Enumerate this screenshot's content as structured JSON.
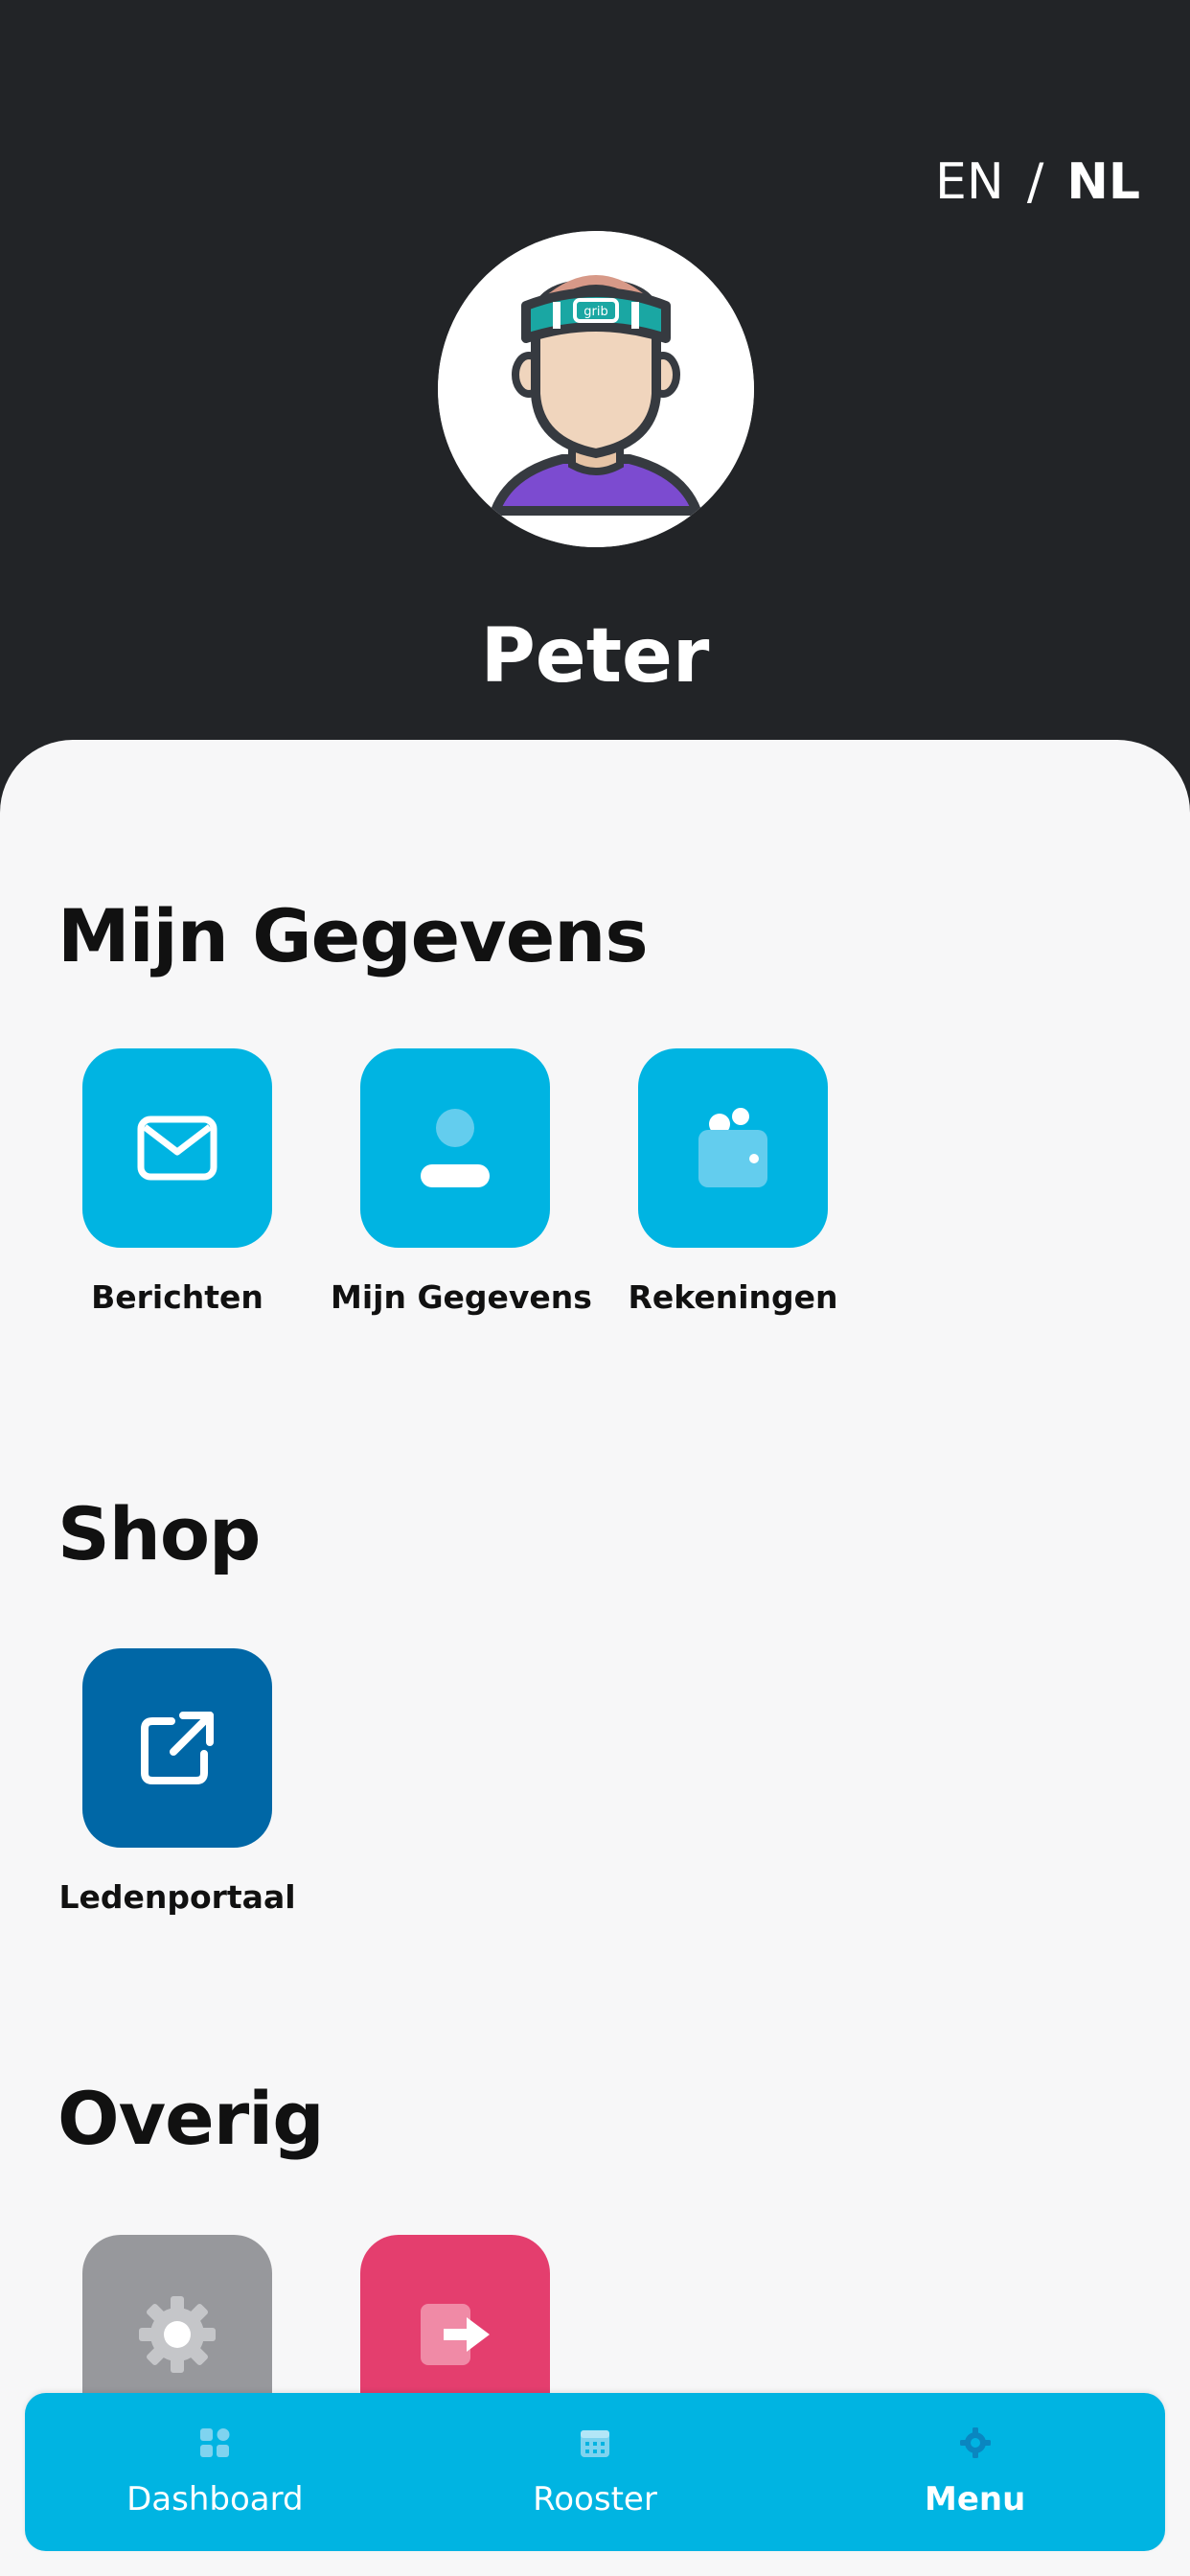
{
  "header": {
    "lang_en": "EN",
    "lang_separator": "/",
    "lang_nl": "NL",
    "active_lang": "NL",
    "avatar_badge_text": "grib",
    "username": "Peter"
  },
  "sections": [
    {
      "title": "Mijn Gegevens",
      "items": [
        {
          "label": "Berichten",
          "icon": "envelope-icon",
          "color": "#00b4e2"
        },
        {
          "label": "Mijn Gegevens",
          "icon": "user-icon",
          "color": "#00b4e2"
        },
        {
          "label": "Rekeningen",
          "icon": "wallet-icon",
          "color": "#00b4e2"
        }
      ]
    },
    {
      "title": "Shop",
      "items": [
        {
          "label": "Ledenportaal",
          "icon": "external-link-icon",
          "color": "#0067a6"
        }
      ]
    },
    {
      "title": "Overig",
      "items": [
        {
          "label": "",
          "icon": "gear-icon",
          "color": "#97989c"
        },
        {
          "label": "",
          "icon": "logout-icon",
          "color": "#e43e6e"
        }
      ]
    }
  ],
  "navbar": {
    "items": [
      {
        "label": "Dashboard",
        "icon": "dashboard-icon"
      },
      {
        "label": "Rooster",
        "icon": "calendar-icon"
      },
      {
        "label": "Menu",
        "icon": "gear-icon",
        "active": true
      }
    ],
    "color": "#00b4e2"
  },
  "colors": {
    "header_bg": "#222427",
    "accent": "#00b4e2",
    "shop_tile": "#0067a6",
    "settings_tile": "#97989c",
    "logout_tile": "#e43e6e"
  }
}
